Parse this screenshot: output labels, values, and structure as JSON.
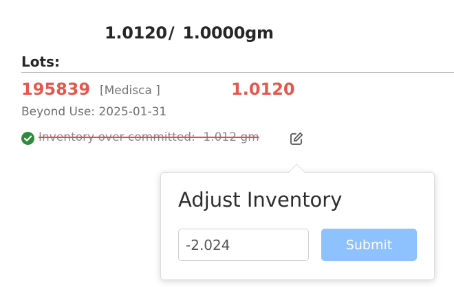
{
  "quantity": {
    "committed": "1.0120",
    "separator": "/",
    "required": "1.0000gm"
  },
  "lots": {
    "title": "Lots:",
    "items": [
      {
        "lot_number": "195839",
        "vendor": "[Medisca ]",
        "quantity": "1.0120",
        "beyond_use": "Beyond Use: 2025-01-31",
        "status": "Inventory over committed: -1.012 gm",
        "status_icon": "check-circle-icon",
        "edit_icon": "edit-icon"
      }
    ]
  },
  "popover": {
    "title": "Adjust Inventory",
    "input_value": "-2.024",
    "submit_label": "Submit"
  },
  "colors": {
    "lot_red": "#e8574c",
    "status_green": "#2f8a3c",
    "strike_red": "#e54b3b",
    "submit_blue": "#8ec2ff"
  }
}
